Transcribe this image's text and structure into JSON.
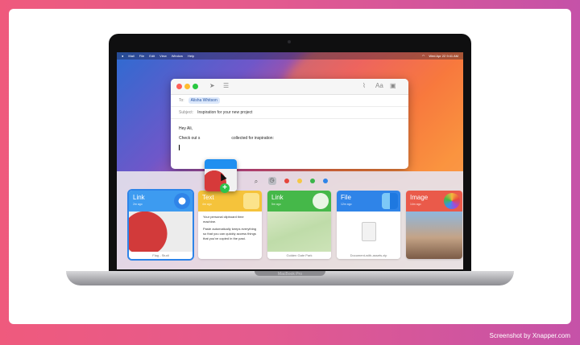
{
  "credit": "Screenshot by Xnapper.com",
  "laptop": {
    "brand": "MacBook Pro"
  },
  "menubar": {
    "items": [
      "Mail",
      "File",
      "Edit",
      "View",
      "Window",
      "Help"
    ],
    "clock": "Wed Apr 22 9:41 AM"
  },
  "mail": {
    "to_label": "To:",
    "to_value": "Alisha Whitson",
    "subject_label": "Subject:",
    "subject_value": "Inspiration for your new project",
    "greeting": "Hey Ali,",
    "body_start": "Check out s",
    "body_end": "collected for inspiration:"
  },
  "shelf": {
    "colors": [
      "#e5453b",
      "#f6c744",
      "#3bb54a",
      "#2f84e8"
    ],
    "cards": [
      {
        "title": "Link",
        "sub": "2m ago",
        "color": "#3d9bf0",
        "footer": "Flag - Studi"
      },
      {
        "title": "Text",
        "sub": "4m ago",
        "color": "#f5c33b",
        "text": "Your personal clipboard time machine.",
        "text2": "Paste automatically keeps everything so that you can quickly access things that you've copied in the past."
      },
      {
        "title": "Link",
        "sub": "5m ago",
        "color": "#45b849",
        "footer": "Golden Gate Park"
      },
      {
        "title": "File",
        "sub": "12m ago",
        "color": "#2f84e8",
        "footer": "Document-with-assets.zip"
      },
      {
        "title": "Image",
        "sub": "14m ago",
        "color": "#ea5a4a"
      }
    ]
  }
}
